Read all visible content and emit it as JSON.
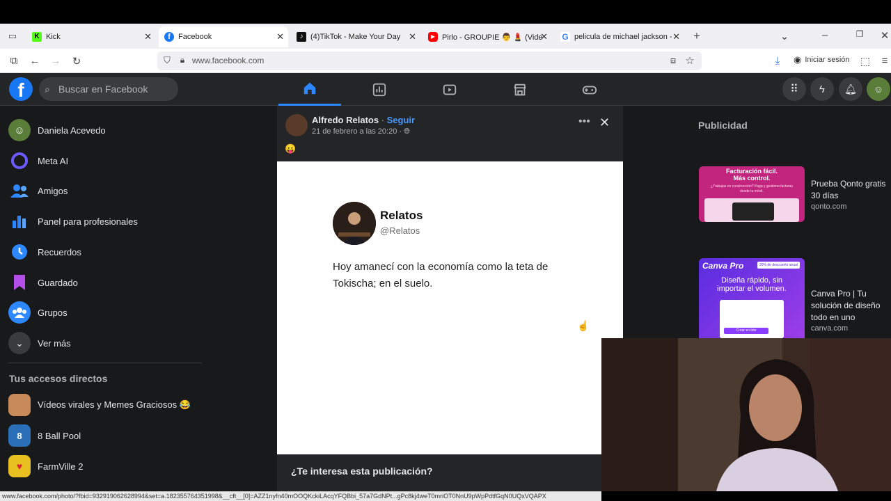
{
  "browser": {
    "tabs": [
      {
        "title": "Kick",
        "color": "#53fc18"
      },
      {
        "title": "Facebook",
        "color": "#1877f2"
      },
      {
        "title": "(4)TikTok - Make Your Day",
        "color": "#111111"
      },
      {
        "title": "Pirlo - GROUPIE 👨 💄 (Vide",
        "color": "#ff0000"
      },
      {
        "title": "pelicula de michael jackson - B",
        "color": "#4285f4"
      }
    ],
    "new_tab_symbol": "+",
    "close_symbol": "✕",
    "url": "www.facebook.com",
    "signin_label": "Iniciar sesión"
  },
  "fb_header": {
    "logo_letter": "f",
    "search_placeholder": "Buscar en Facebook"
  },
  "sidebar": {
    "items": [
      {
        "label": "Daniela Acevedo",
        "icon": "avatar-icon",
        "color": "#5b7d3a"
      },
      {
        "label": "Meta AI",
        "icon": "meta-ai-icon",
        "color": "#0064e0"
      },
      {
        "label": "Amigos",
        "icon": "friends-icon",
        "color": "#1b74e4"
      },
      {
        "label": "Panel para profesionales",
        "icon": "dashboard-icon",
        "color": "#1b74e4"
      },
      {
        "label": "Recuerdos",
        "icon": "memories-icon",
        "color": "#1b74e4"
      },
      {
        "label": "Guardado",
        "icon": "saved-icon",
        "color": "#9b3ee0"
      },
      {
        "label": "Grupos",
        "icon": "groups-icon",
        "color": "#1b74e4"
      },
      {
        "label": "Ver más",
        "icon": "chevron-down-icon",
        "color": "#3a3b3c"
      }
    ],
    "shortcuts_title": "Tus accesos directos",
    "shortcuts": [
      {
        "label": "Vídeos virales y Memes Graciosos 😂",
        "color": "#c98a5a"
      },
      {
        "label": "8 Ball Pool",
        "color": "#2a6fb8"
      },
      {
        "label": "FarmVille 2",
        "color": "#e8c020"
      }
    ]
  },
  "post": {
    "author": "Alfredo Relatos",
    "separator": " · ",
    "follow_label": "Seguir",
    "date": "21 de febrero a las 20:20 · ",
    "emoji": "😛",
    "more_symbol": "•••",
    "close_symbol": "✕",
    "embedded": {
      "name": "Relatos",
      "handle": "@Relatos",
      "text": "Hoy amanecí con la economía como la teta de Tokischa; en el suelo."
    },
    "interest_prompt": "¿Te interesa esta publicación?"
  },
  "ads": {
    "title": "Publicidad",
    "items": [
      {
        "headline": "Prueba Qonto gratis 30 días",
        "domain": "qonto.com",
        "banner_line1": "Facturación fácil.",
        "banner_line2": "Más control.",
        "banner_sub": "¿Trabajas en construcción? Paga y gestiona facturas desde tu móvil."
      },
      {
        "headline": "Canva Pro | Tu solución de diseño todo en uno",
        "domain": "canva.com",
        "banner_brand": "Canva Pro",
        "banner_badge": "20% de descuento anual",
        "banner_line1": "Diseña rápido, sin",
        "banner_line2": "importar el volumen.",
        "banner_btn": "Crear en lote"
      }
    ]
  },
  "status_url": "www.facebook.com/photo/?fbid=932919062628994&set=a.182355764351998&__cft__[0]=AZZ1nyfn40mOOQKckiLAcqYFQBbi_57a7GdNPt...gPc8kj4weT0mriOT0NnU9pWpPdtfGqN0UQxVQAPX"
}
